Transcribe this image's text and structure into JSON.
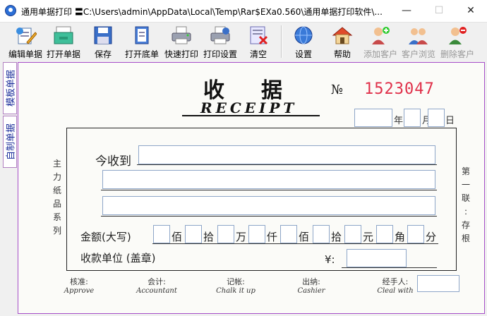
{
  "window": {
    "title": "通用单据打印 〓C:\\Users\\admin\\AppData\\Local\\Temp\\Rar$EXa0.560\\通用单据打印软件\\...",
    "minimize": "—",
    "maximize": "☐",
    "close": "✕"
  },
  "toolbar": {
    "edit": "编辑单据",
    "open": "打开单据",
    "save": "保存",
    "open_base": "打开底单",
    "quick_print": "快速打印",
    "print_settings": "打印设置",
    "clear": "清空",
    "settings": "设置",
    "help": "帮助",
    "add_customer": "添加客户",
    "browse_customer": "客户浏览",
    "delete_customer": "删除客户"
  },
  "side_tabs": [
    "模板单据",
    "自制单据"
  ],
  "receipt": {
    "title": "收据",
    "subtitle": "RECEIPT",
    "no_label": "№",
    "no_value": "1523047",
    "year": "年",
    "month": "月",
    "day": "日",
    "received_from": "今收到",
    "left_vertical": [
      "主",
      "力",
      "纸",
      "品",
      "系",
      "列"
    ],
    "right_vertical": [
      "第",
      "一",
      "联",
      ":",
      "存",
      "根"
    ],
    "amount_label": "金额(大写)",
    "units": [
      "佰",
      "拾",
      "万",
      "仟",
      "佰",
      "拾",
      "元",
      "角",
      "分"
    ],
    "payee_label": "收款单位 (盖章)",
    "yen": "¥:",
    "footer": [
      {
        "cn": "核准:",
        "en": "Approve"
      },
      {
        "cn": "会计:",
        "en": "Accountant"
      },
      {
        "cn": "记帐:",
        "en": "Chalk it up"
      },
      {
        "cn": "出纳:",
        "en": "Cashier"
      },
      {
        "cn": "经手人:",
        "en": "Cleal with"
      }
    ]
  },
  "colors": {
    "receipt_number": "#e0304a",
    "field_border": "#8ea6c8",
    "paper_border": "#a64dc8"
  }
}
